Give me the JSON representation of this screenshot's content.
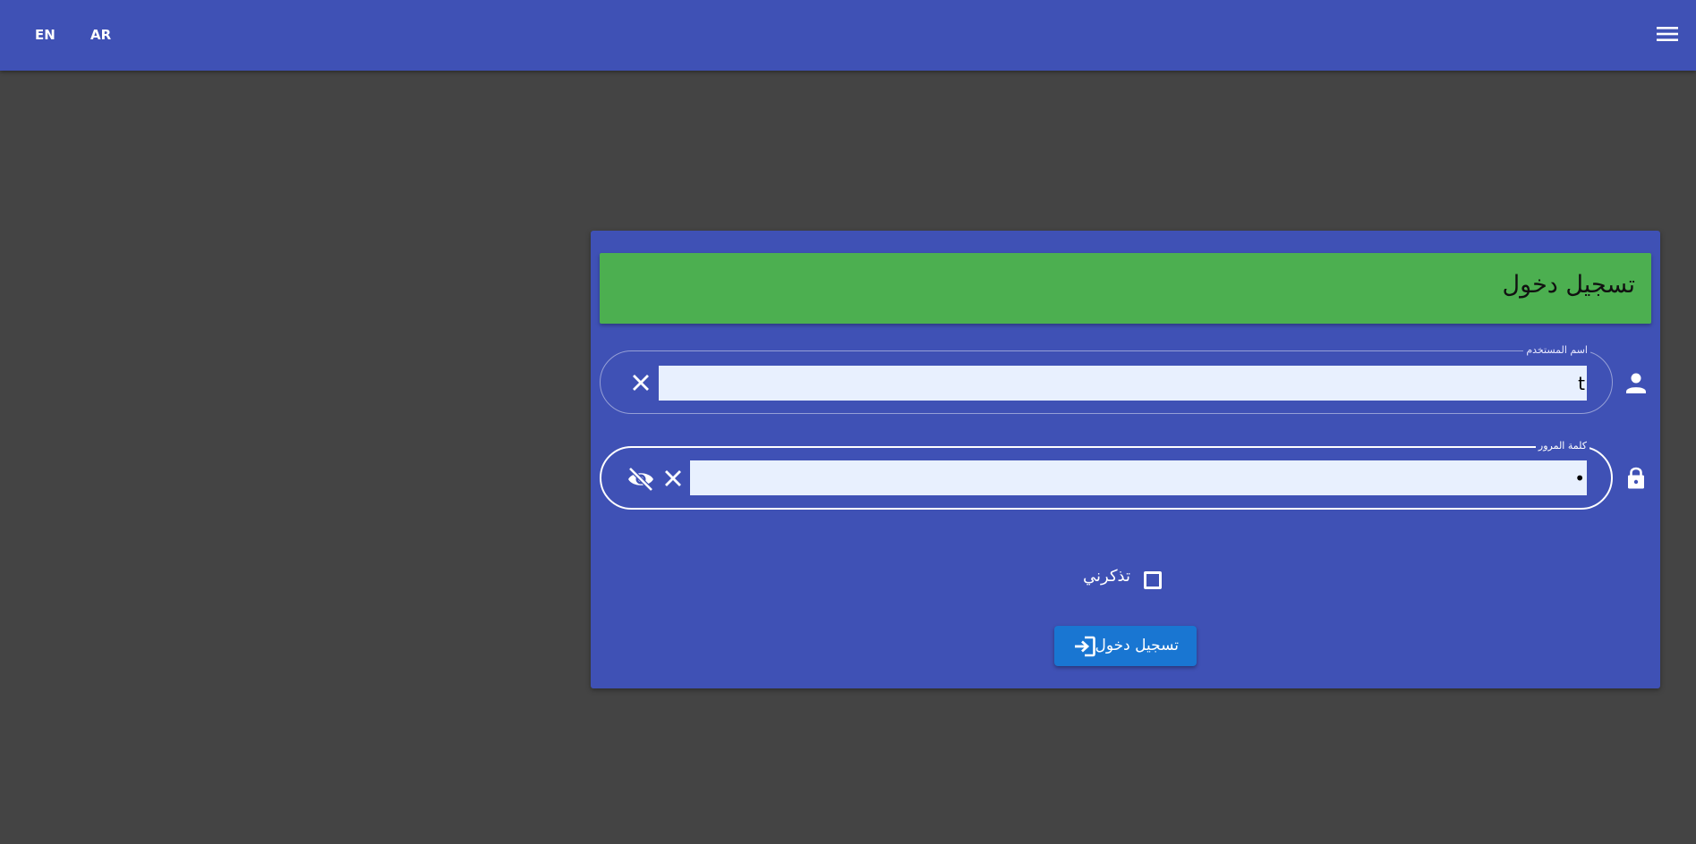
{
  "topbar": {
    "lang_en": "EN",
    "lang_ar": "AR",
    "menu_icon": "hamburger-menu-icon"
  },
  "login_card": {
    "title": "تسجيل دخول",
    "username": {
      "label": "اسم المستخدم",
      "value": "t",
      "icon": "person-icon",
      "clear_icon": "close-icon"
    },
    "password": {
      "label": "كلمة المرور",
      "value": "•",
      "icon": "lock-icon",
      "clear_icon": "close-icon",
      "visibility_icon": "visibility-off-icon"
    },
    "remember_me": {
      "label": "تذكرني",
      "checked": false
    },
    "submit": {
      "label": "تسجيل دخول",
      "icon": "login-icon"
    }
  },
  "colors": {
    "primary": "#3f51b5",
    "header_green": "#4caf50",
    "button_blue": "#1976d2",
    "background": "#444444",
    "input_fill": "#e8f0fe"
  }
}
